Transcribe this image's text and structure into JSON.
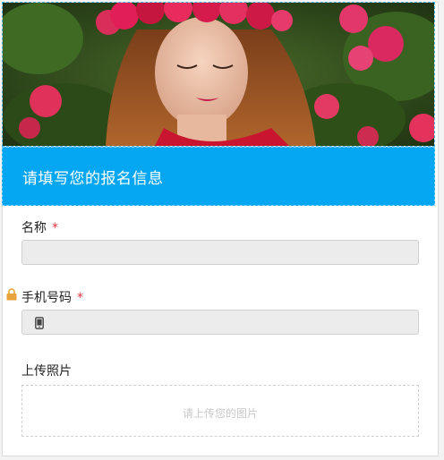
{
  "form": {
    "title": "请填写您的报名信息",
    "fields": [
      {
        "label": "名称",
        "required": "*",
        "value": ""
      },
      {
        "label": "手机号码",
        "required": "*",
        "value": ""
      },
      {
        "label": "上传照片",
        "upload_hint": "请上传您的图片"
      }
    ]
  },
  "icons": {
    "lock": "lock-icon",
    "phone": "mobile-phone-icon"
  },
  "colors": {
    "title_bar": "#05a6f2",
    "required_star": "#e0393e",
    "lock": "#e8a33a"
  }
}
